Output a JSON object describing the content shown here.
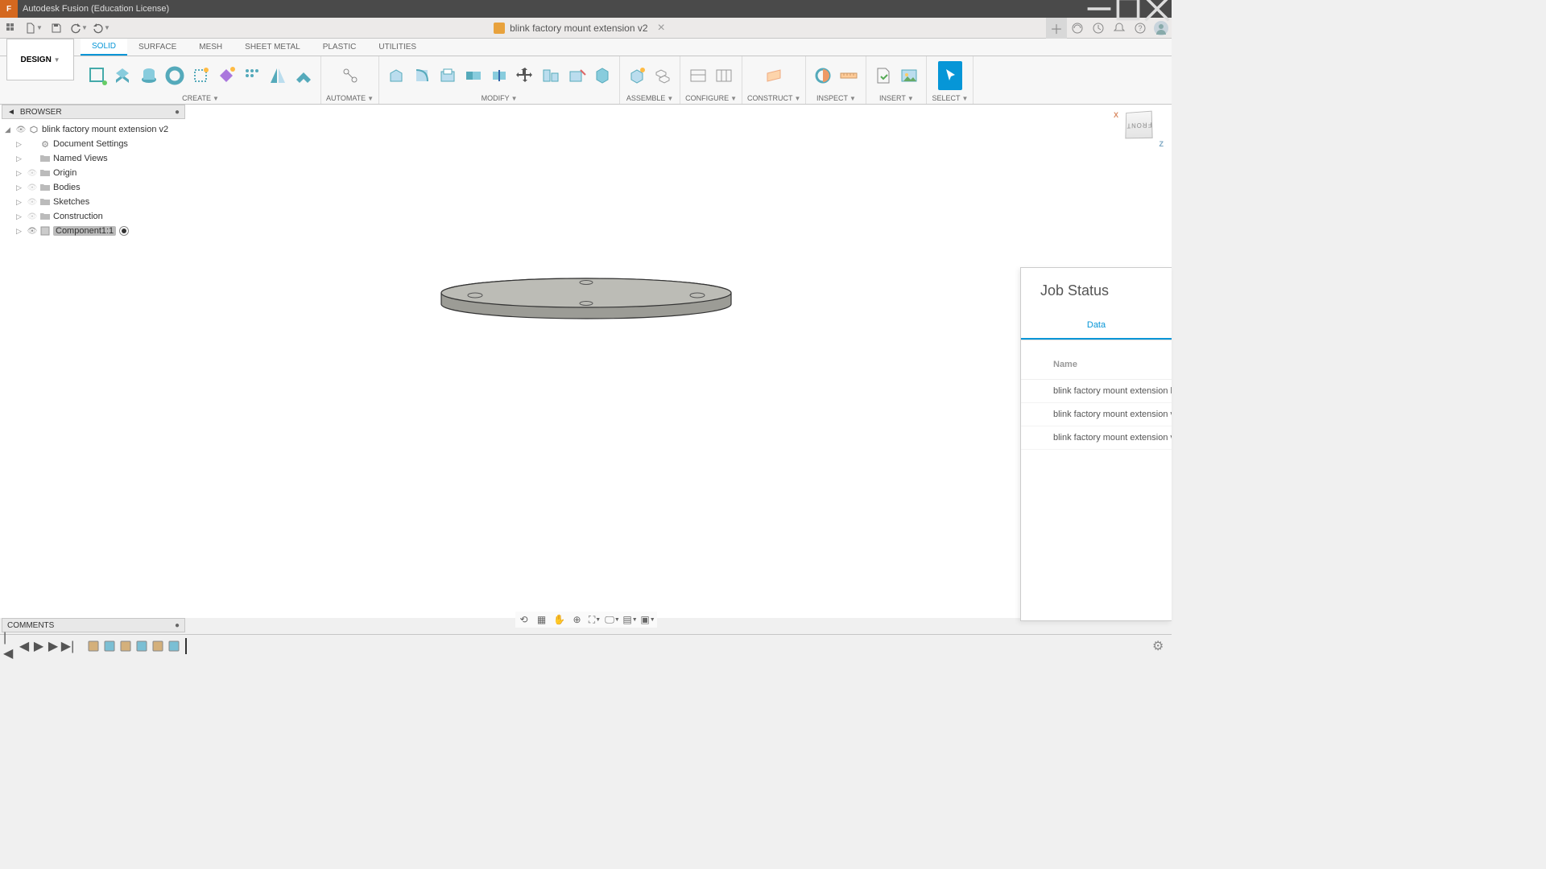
{
  "titlebar": {
    "title": "Autodesk Fusion (Education License)"
  },
  "document": {
    "name": "blink factory mount extension v2"
  },
  "workspace": {
    "label": "DESIGN"
  },
  "tabs": [
    "SOLID",
    "SURFACE",
    "MESH",
    "SHEET METAL",
    "PLASTIC",
    "UTILITIES"
  ],
  "active_tab": 0,
  "ribbon_groups": [
    "CREATE",
    "AUTOMATE",
    "MODIFY",
    "ASSEMBLE",
    "CONFIGURE",
    "CONSTRUCT",
    "INSPECT",
    "INSERT",
    "SELECT"
  ],
  "browser": {
    "title": "BROWSER",
    "root": "blink factory mount extension v2",
    "items": [
      {
        "label": "Document Settings",
        "icon": "gear",
        "vis": false
      },
      {
        "label": "Named Views",
        "icon": "folder",
        "vis": false
      },
      {
        "label": "Origin",
        "icon": "folder",
        "vis": true,
        "dim": true
      },
      {
        "label": "Bodies",
        "icon": "folder",
        "vis": true,
        "dim": true
      },
      {
        "label": "Sketches",
        "icon": "folder",
        "vis": true,
        "dim": true
      },
      {
        "label": "Construction",
        "icon": "folder",
        "vis": true,
        "dim": true
      },
      {
        "label": "Component1:1",
        "icon": "component",
        "vis": true,
        "active": true,
        "hl": true
      }
    ]
  },
  "comments": {
    "title": "COMMENTS"
  },
  "viewcube": {
    "face": "FRONT",
    "x": "X",
    "z": "Z"
  },
  "jobstatus": {
    "title": "Job Status",
    "tab": "Data",
    "col": "Name",
    "rows": [
      "blink factory mount extension b",
      "blink factory mount extension v",
      "blink factory mount extension v"
    ]
  },
  "timeline_features": 6
}
